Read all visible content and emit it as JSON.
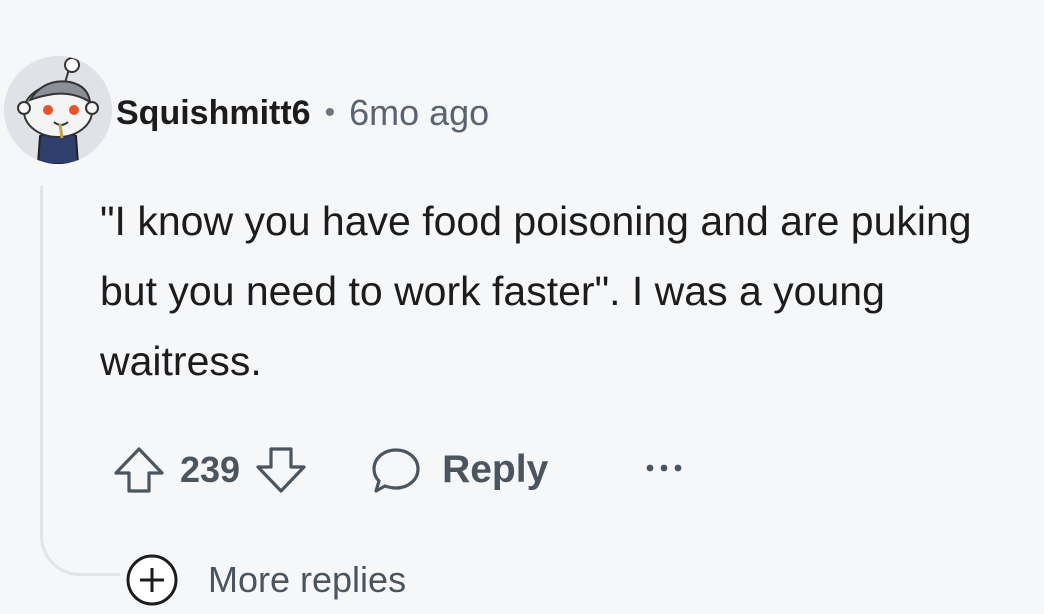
{
  "comment": {
    "avatar_icon": "snoo-avatar-icon",
    "username": "Squishmitt6",
    "separator": "•",
    "timestamp": "6mo ago",
    "body": "\"I know you have food poisoning and are puking but you need to work faster\". I was a young waitress.",
    "score": "239",
    "reply_label": "Reply",
    "more_replies_label": "More replies"
  },
  "icons": {
    "upvote": "arrow-up-icon",
    "downvote": "arrow-down-icon",
    "reply": "speech-bubble-icon",
    "overflow": "ellipsis-icon",
    "expand": "plus-circle-icon"
  },
  "colors": {
    "background": "#f6f7f9",
    "text": "#1c1c1c",
    "muted": "#4a5560"
  }
}
